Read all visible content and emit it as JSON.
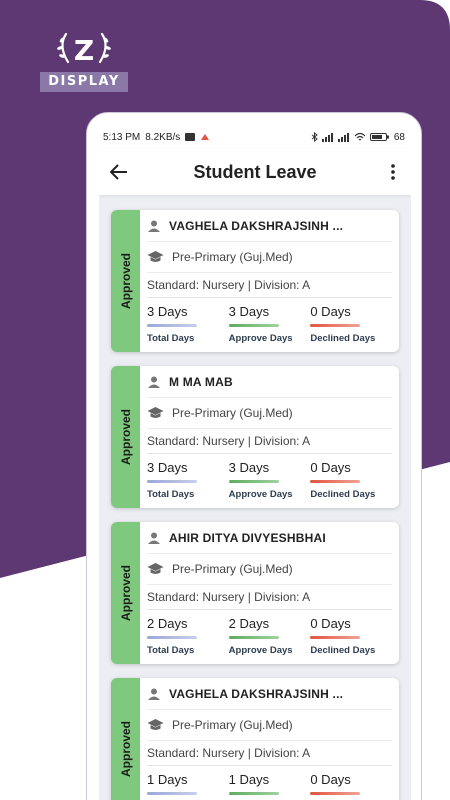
{
  "brand": {
    "logo_letter": "Z",
    "logo_label": "DISPLAY"
  },
  "colors": {
    "purple": "#5e3873",
    "approved": "#7ec97d"
  },
  "status_bar": {
    "time": "5:13 PM",
    "speed": "8.2KB/s",
    "battery": "68"
  },
  "appbar": {
    "title": "Student Leave",
    "back_icon": "arrow-back-icon",
    "menu_icon": "more-vertical-icon"
  },
  "leaves": [
    {
      "status": "Approved",
      "name": "VAGHELA DAKSHRAJSINH ...",
      "course": "Pre-Primary (Guj.Med)",
      "standard": "Standard: Nursery | Division: A",
      "total_days": "3 Days",
      "approve_days": "3 Days",
      "declined_days": "0 Days"
    },
    {
      "status": "Approved",
      "name": "M MA MAB",
      "course": "Pre-Primary (Guj.Med)",
      "standard": "Standard: Nursery | Division: A",
      "total_days": "3 Days",
      "approve_days": "3 Days",
      "declined_days": "0 Days"
    },
    {
      "status": "Approved",
      "name": "AHIR DITYA DIVYESHBHAI",
      "course": "Pre-Primary (Guj.Med)",
      "standard": "Standard: Nursery | Division: A",
      "total_days": "2 Days",
      "approve_days": "2 Days",
      "declined_days": "0 Days"
    },
    {
      "status": "Approved",
      "name": "VAGHELA DAKSHRAJSINH ...",
      "course": "Pre-Primary (Guj.Med)",
      "standard": "Standard: Nursery | Division: A",
      "total_days": "1 Days",
      "approve_days": "1 Days",
      "declined_days": "0 Days"
    }
  ],
  "labels": {
    "total": "Total Days",
    "approve": "Approve Days",
    "declined": "Declined Days"
  }
}
